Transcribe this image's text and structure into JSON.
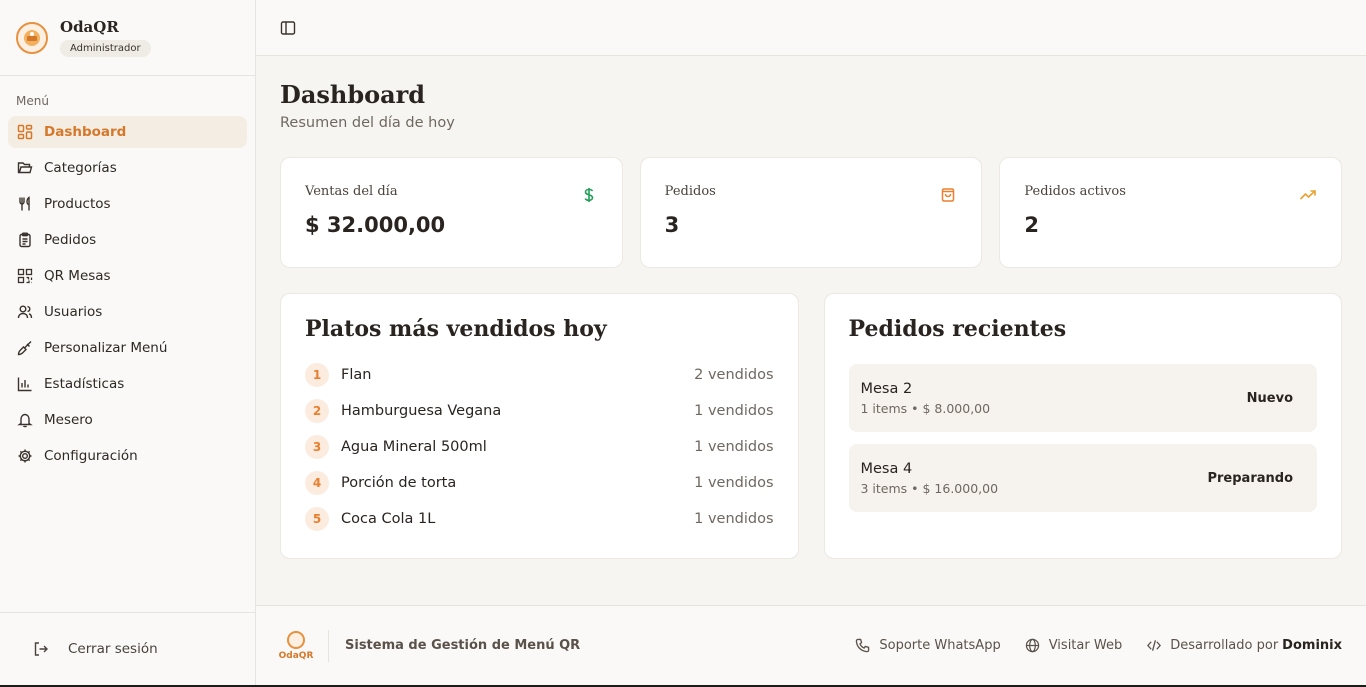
{
  "brand": {
    "name": "OdaQR",
    "role": "Administrador",
    "logo_icon": "odaqr-logo"
  },
  "sidebar": {
    "menu_label": "Menú",
    "items": [
      {
        "label": "Dashboard",
        "icon": "dashboard-icon",
        "active": true
      },
      {
        "label": "Categorías",
        "icon": "folder-icon"
      },
      {
        "label": "Productos",
        "icon": "utensils-icon"
      },
      {
        "label": "Pedidos",
        "icon": "clipboard-icon"
      },
      {
        "label": "QR Mesas",
        "icon": "qr-code-icon"
      },
      {
        "label": "Usuarios",
        "icon": "users-icon"
      },
      {
        "label": "Personalizar Menú",
        "icon": "paintbrush-icon"
      },
      {
        "label": "Estadísticas",
        "icon": "bar-chart-icon"
      },
      {
        "label": "Mesero",
        "icon": "bell-icon"
      },
      {
        "label": "Configuración",
        "icon": "gear-icon"
      }
    ],
    "logout_label": "Cerrar sesión"
  },
  "page": {
    "title": "Dashboard",
    "subtitle": "Resumen del día de hoy"
  },
  "stats": [
    {
      "label": "Ventas del día",
      "value": "$ 32.000,00",
      "icon": "dollar-icon",
      "color": "#22a05a"
    },
    {
      "label": "Pedidos",
      "value": "3",
      "icon": "shopping-bag-icon",
      "color": "#e8802f"
    },
    {
      "label": "Pedidos activos",
      "value": "2",
      "icon": "trending-up-icon",
      "color": "#e8a22f"
    }
  ],
  "top_dishes": {
    "title": "Platos más vendidos hoy",
    "items": [
      {
        "rank": "1",
        "name": "Flan",
        "count": "2 vendidos"
      },
      {
        "rank": "2",
        "name": "Hamburguesa Vegana",
        "count": "1 vendidos"
      },
      {
        "rank": "3",
        "name": "Agua Mineral 500ml",
        "count": "1 vendidos"
      },
      {
        "rank": "4",
        "name": "Porción de torta",
        "count": "1 vendidos"
      },
      {
        "rank": "5",
        "name": "Coca Cola 1L",
        "count": "1 vendidos"
      }
    ]
  },
  "recent_orders": {
    "title": "Pedidos recientes",
    "items": [
      {
        "table": "Mesa 2",
        "meta": "1 items • $ 8.000,00",
        "status": "Nuevo"
      },
      {
        "table": "Mesa 4",
        "meta": "3 items • $ 16.000,00",
        "status": "Preparando"
      }
    ]
  },
  "footer": {
    "logo_text": "OdaQR",
    "system": "Sistema de Gestión de Menú QR",
    "whatsapp": "Soporte WhatsApp",
    "web": "Visitar Web",
    "dev_prefix": "Desarrollado por",
    "dev_name": "Dominix"
  },
  "colors": {
    "accent": "#d6782a",
    "active_bg": "#f4ede3"
  }
}
